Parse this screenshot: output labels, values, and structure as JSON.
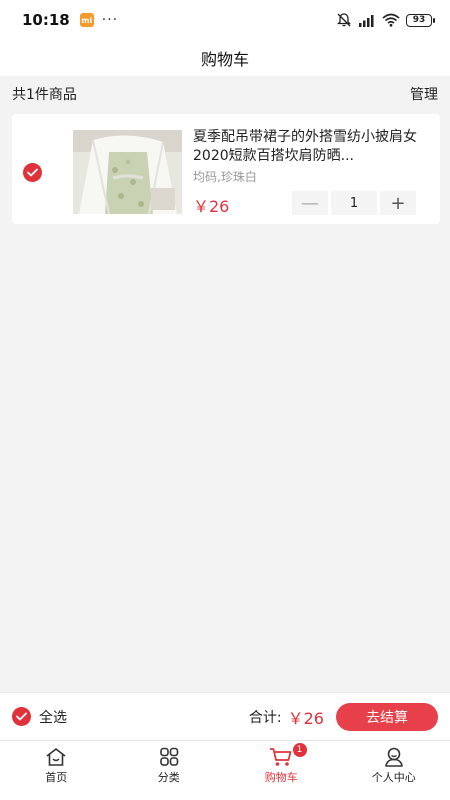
{
  "status_bar": {
    "time": "10:18",
    "mi_label": "mi",
    "dots": "···",
    "battery": "93"
  },
  "header": {
    "title": "购物车"
  },
  "summary": {
    "count_text": "共1件商品",
    "manage_label": "管理"
  },
  "cart_items": [
    {
      "title": "夏季配吊带裙子的外搭雪纺小披肩女2020短款百搭坎肩防晒...",
      "spec": "均码,珍珠白",
      "price": "￥26",
      "quantity": "1",
      "minus_label": "—",
      "plus_label": "+",
      "checked": true
    }
  ],
  "footer": {
    "select_all_label": "全选",
    "total_label": "合计:",
    "total_price": "￥26",
    "checkout_label": "去结算"
  },
  "tabs": [
    {
      "label": "首页",
      "icon": "home-icon"
    },
    {
      "label": "分类",
      "icon": "category-icon"
    },
    {
      "label": "购物车",
      "icon": "cart-icon",
      "badge": "1",
      "active": true
    },
    {
      "label": "个人中心",
      "icon": "profile-icon"
    }
  ],
  "colors": {
    "accent": "#e0323b",
    "checkout_button": "#e8404a",
    "background": "#f3f3f3",
    "mi_badge": "#f39a2b"
  }
}
